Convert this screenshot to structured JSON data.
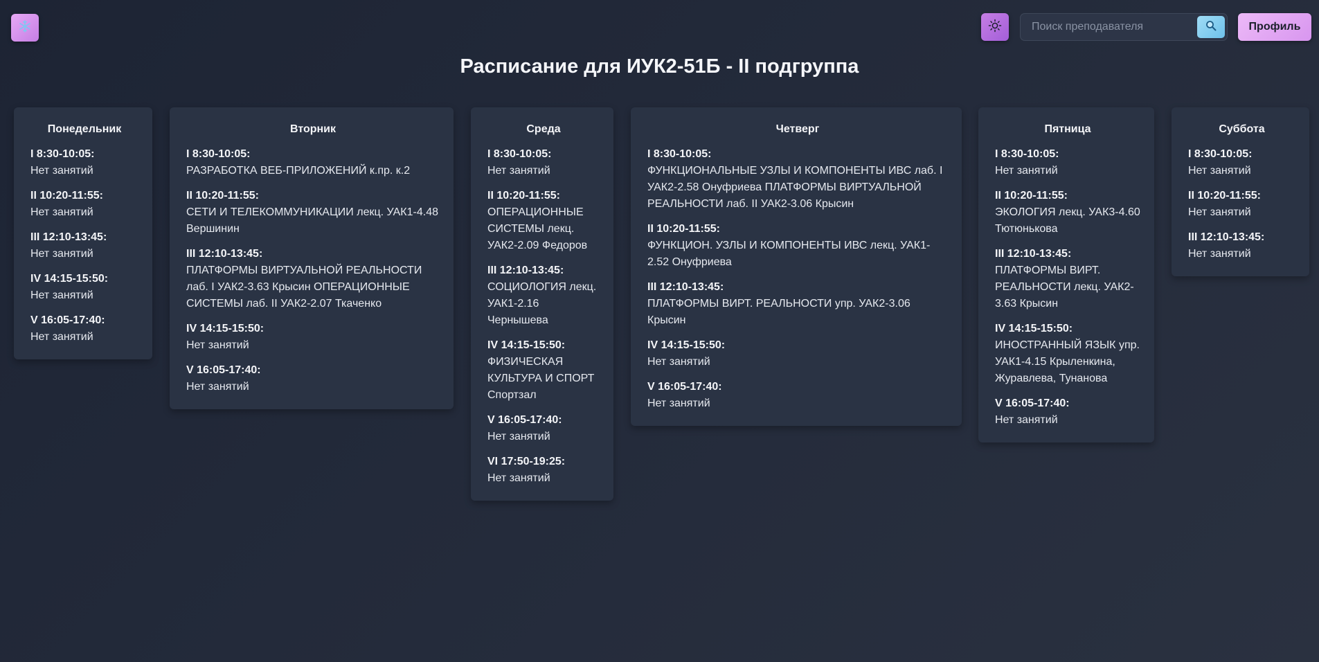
{
  "header": {
    "title": "Расписание для ИУК2-51Б - II подгруппа",
    "search_placeholder": "Поиск преподавателя",
    "profile_label": "Профиль",
    "theme_icon": "sun-icon",
    "snow_icon": "snowflake-icon",
    "search_icon": "magnifier-icon"
  },
  "colors": {
    "accent_purple": "#c57ee4",
    "accent_pink": "#e7a9f5",
    "accent_blue": "#6ec1ea",
    "card_bg": "#2a3344",
    "page_bg": "#1f2636"
  },
  "days": [
    {
      "name": "Понедельник",
      "slots": [
        {
          "time": "I 8:30-10:05:",
          "text": "Нет занятий"
        },
        {
          "time": "II 10:20-11:55:",
          "text": "Нет занятий"
        },
        {
          "time": "III 12:10-13:45:",
          "text": "Нет занятий"
        },
        {
          "time": "IV 14:15-15:50:",
          "text": "Нет занятий"
        },
        {
          "time": "V 16:05-17:40:",
          "text": "Нет занятий"
        }
      ]
    },
    {
      "name": "Вторник",
      "slots": [
        {
          "time": "I 8:30-10:05:",
          "text": "РАЗРАБОТКА ВЕБ-ПРИЛОЖЕНИЙ к.пр. к.2"
        },
        {
          "time": "II 10:20-11:55:",
          "text": "СЕТИ И ТЕЛЕКОММУНИКАЦИИ лекц. УАК1-4.48 Вершинин"
        },
        {
          "time": "III 12:10-13:45:",
          "text": "ПЛАТФОРМЫ ВИРТУАЛЬНОЙ РЕАЛЬНОСТИ лаб. I УАК2-3.63 Крысин ОПЕРАЦИОННЫЕ СИСТЕМЫ лаб. II УАК2-2.07 Ткаченко"
        },
        {
          "time": "IV 14:15-15:50:",
          "text": "Нет занятий"
        },
        {
          "time": "V 16:05-17:40:",
          "text": "Нет занятий"
        }
      ]
    },
    {
      "name": "Среда",
      "slots": [
        {
          "time": "I 8:30-10:05:",
          "text": "Нет занятий"
        },
        {
          "time": "II 10:20-11:55:",
          "text": "ОПЕРАЦИОННЫЕ СИСТЕМЫ лекц. УАК2-2.09 Федоров"
        },
        {
          "time": "III 12:10-13:45:",
          "text": "СОЦИОЛОГИЯ лекц. УАК1-2.16 Чернышева"
        },
        {
          "time": "IV 14:15-15:50:",
          "text": "ФИЗИЧЕСКАЯ КУЛЬТУРА И СПОРТ Спортзал"
        },
        {
          "time": "V 16:05-17:40:",
          "text": "Нет занятий"
        },
        {
          "time": "VI 17:50-19:25:",
          "text": "Нет занятий"
        }
      ]
    },
    {
      "name": "Четверг",
      "slots": [
        {
          "time": "I 8:30-10:05:",
          "text": "ФУНКЦИОНАЛЬНЫЕ УЗЛЫ И КОМПОНЕНТЫ ИВС лаб. I УАК2-2.58 Онуфриева ПЛАТФОРМЫ ВИРТУАЛЬНОЙ РЕАЛЬНОСТИ лаб. II УАК2-3.06 Крысин"
        },
        {
          "time": "II 10:20-11:55:",
          "text": "ФУНКЦИОН. УЗЛЫ И КОМПОНЕНТЫ ИВС лекц. УАК1-2.52 Онуфриева"
        },
        {
          "time": "III 12:10-13:45:",
          "text": "ПЛАТФОРМЫ ВИРТ. РЕАЛЬНОСТИ упр. УАК2-3.06 Крысин"
        },
        {
          "time": "IV 14:15-15:50:",
          "text": "Нет занятий"
        },
        {
          "time": "V 16:05-17:40:",
          "text": "Нет занятий"
        }
      ]
    },
    {
      "name": "Пятница",
      "slots": [
        {
          "time": "I 8:30-10:05:",
          "text": "Нет занятий"
        },
        {
          "time": "II 10:20-11:55:",
          "text": "ЭКОЛОГИЯ лекц. УАК3-4.60 Тютюнькова"
        },
        {
          "time": "III 12:10-13:45:",
          "text": "ПЛАТФОРМЫ ВИРТ. РЕАЛЬНОСТИ лекц. УАК2-3.63 Крысин"
        },
        {
          "time": "IV 14:15-15:50:",
          "text": "ИНОСТРАННЫЙ ЯЗЫК упр. УАК1-4.15 Крыленкина, Журавлева, Тунанова"
        },
        {
          "time": "V 16:05-17:40:",
          "text": "Нет занятий"
        }
      ]
    },
    {
      "name": "Суббота",
      "slots": [
        {
          "time": "I 8:30-10:05:",
          "text": "Нет занятий"
        },
        {
          "time": "II 10:20-11:55:",
          "text": "Нет занятий"
        },
        {
          "time": "III 12:10-13:45:",
          "text": "Нет занятий"
        }
      ]
    }
  ]
}
